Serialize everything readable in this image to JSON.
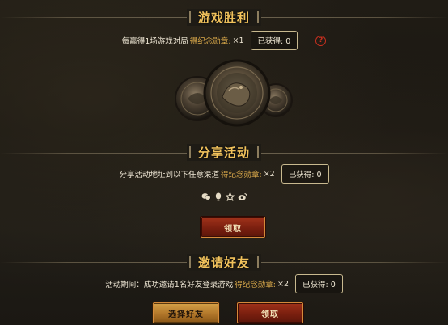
{
  "win": {
    "title": "游戏胜利",
    "desc_prefix": "每赢得1场游戏对局",
    "desc_highlight": "得纪念勋章:",
    "desc_multiplier": "×1",
    "count_label": "已获得: 0",
    "help_glyph": "?"
  },
  "share": {
    "title": "分享活动",
    "desc_prefix": "分享活动地址到以下任意渠道",
    "desc_highlight": "得纪念勋章:",
    "desc_multiplier": "×2",
    "count_label": "已获得: 0",
    "icons": [
      "wechat-icon",
      "qq-icon",
      "star-icon",
      "weibo-icon"
    ],
    "claim_label": "领取"
  },
  "invite": {
    "title": "邀请好友",
    "desc_prefix": "活动期间：成功邀请1名好友登录游戏",
    "desc_highlight": "得纪念勋章:",
    "desc_multiplier": "×2",
    "count_label": "已获得: 0",
    "select_label": "选择好友",
    "claim_label": "领取"
  },
  "colors": {
    "accent_gold": "#f1c25c",
    "highlight": "#d9a84a",
    "button_red": "#7a1f0f",
    "button_gold": "#b2772a",
    "help_red": "#c9301f"
  }
}
